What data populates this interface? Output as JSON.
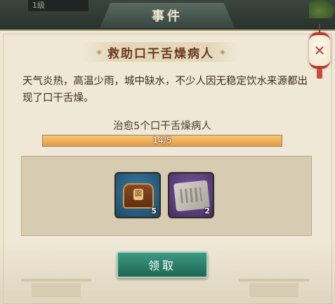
{
  "header": {
    "level_text": "1级",
    "window_title": "事件"
  },
  "lantern": {
    "mark": "✕"
  },
  "event": {
    "title": "救助口干舌燥病人",
    "description": "天气炎热，高温少雨，城中缺水，不少人因无稳定饮水来源都出现了口干舌燥。"
  },
  "task": {
    "label": "治愈5个口干舌燥病人",
    "progress_text": "14/5",
    "progress_fraction": 1.0
  },
  "rewards": [
    {
      "icon": "treasure-chest-icon",
      "count": "5",
      "frame_color": "#3a7da6"
    },
    {
      "icon": "map-scroll-icon",
      "count": "2",
      "frame_color": "#7c5aa3"
    }
  ],
  "actions": {
    "claim_label": "领取"
  }
}
